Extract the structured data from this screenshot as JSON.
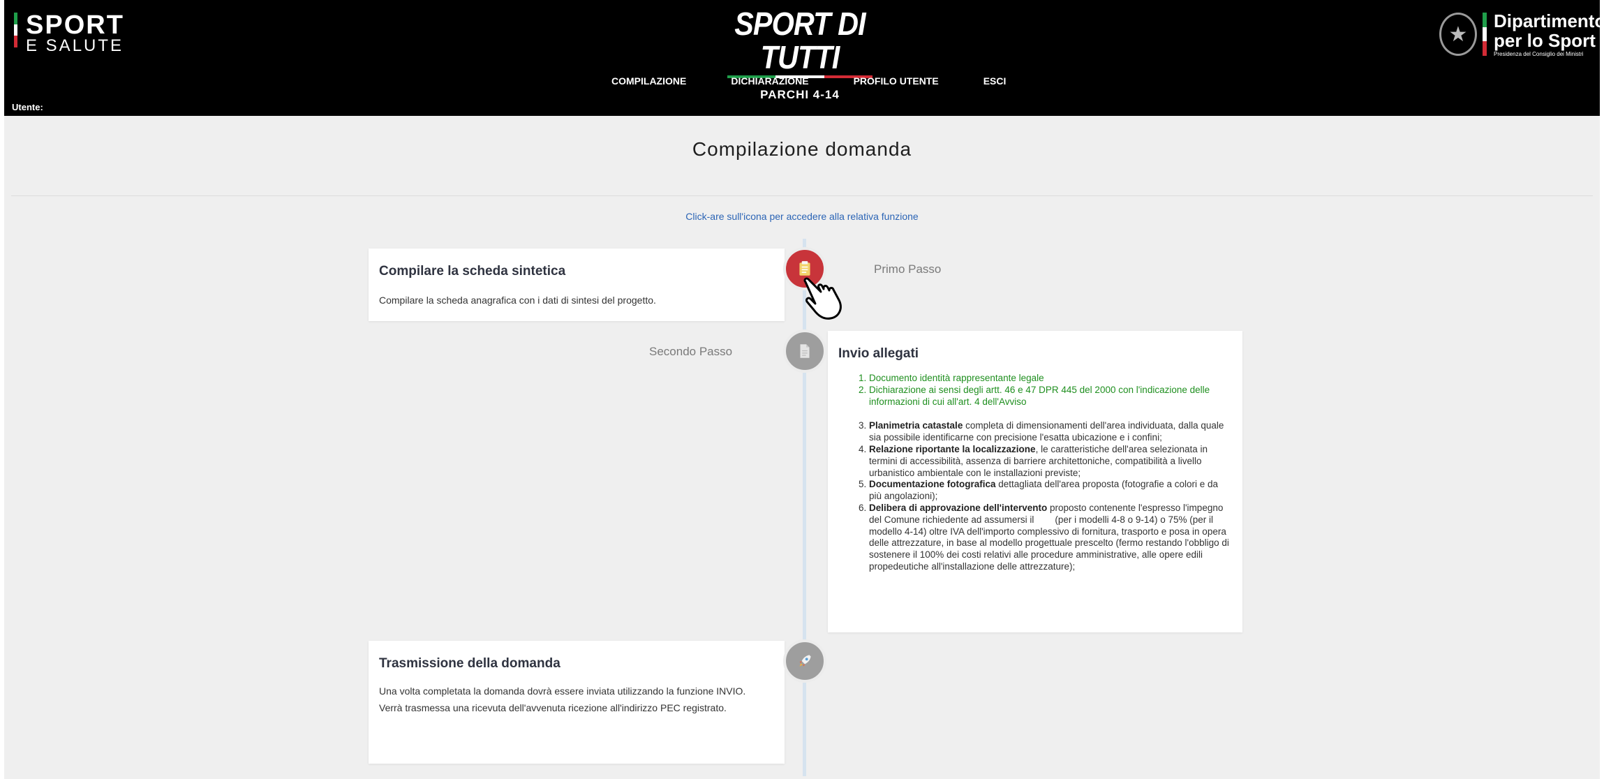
{
  "header": {
    "logo_left": {
      "line1": "SPORT",
      "line2": "E SALUTE"
    },
    "brand": "SPORT DI TUTTI",
    "subbrand": "PARCHI 4-14",
    "nav": [
      "COMPILAZIONE",
      "DICHIARAZIONE",
      "PROFILO UTENTE",
      "ESCI"
    ],
    "user_label": "Utente:",
    "logo_right": {
      "line1": "Dipartimento",
      "line2": "per lo Sport",
      "line3": "Presidenza del Consiglio dei Ministri"
    },
    "colors": {
      "green": "#1f9e4a",
      "white": "#ffffff",
      "red": "#d22b35"
    }
  },
  "main": {
    "title": "Compilazione domanda",
    "hint": "Click-are sull'icona per accedere alla relativa funzione",
    "step1": {
      "label": "Primo Passo",
      "title": "Compilare la scheda sintetica",
      "text": "Compilare la scheda anagrafica con i dati di sintesi del progetto.",
      "icon": "clipboard-icon"
    },
    "step2": {
      "label": "Secondo Passo",
      "title": "Invio allegati",
      "icon": "document-icon",
      "items": [
        {
          "text": "Documento identità rappresentante legale"
        },
        {
          "text": "Dichiarazione ai sensi degli artt. 46 e 47 DPR 445 del 2000 con l'indicazione delle informazioni di cui all'art. 4 dell'Avviso"
        },
        {
          "bold": "Planimetria catastale",
          "text": " completa di dimensionamenti dell'area individuata, dalla quale sia possibile identificarne con precisione l'esatta ubicazione e i confini;"
        },
        {
          "bold": "Relazione riportante la localizzazione",
          "text": ", le caratteristiche dell'area selezionata in termini di accessibilità, assenza di barriere architettoniche, compatibilità a livello urbanistico ambientale con le installazioni previste;"
        },
        {
          "bold": "Documentazione fotografica",
          "text": " dettagliata dell'area proposta (fotografie a colori e da più angolazioni);"
        },
        {
          "bold": "Delibera di approvazione dell'intervento",
          "text": " proposto contenente l'espresso l'impegno del Comune richiedente ad assumersi il        (per i modelli 4-8 o 9-14) o 75% (per il modello 4-14) oltre IVA dell'importo complessivo di fornitura, trasporto e posa in opera delle attrezzature, in base al modello progettuale prescelto (fermo restando l'obbligo di sostenere il 100% dei costi relativi alle procedure amministrative, alle opere edili propedeutiche all'installazione delle attrezzature);"
        }
      ]
    },
    "step3": {
      "title": "Trasmissione della domanda",
      "text1": "Una volta completata la domanda dovrà essere inviata utilizzando la funzione INVIO.",
      "text2": "Verrà trasmessa una ricevuta dell'avvenuta ricezione all'indirizzo PEC registrato.",
      "icon": "rocket-icon"
    }
  }
}
